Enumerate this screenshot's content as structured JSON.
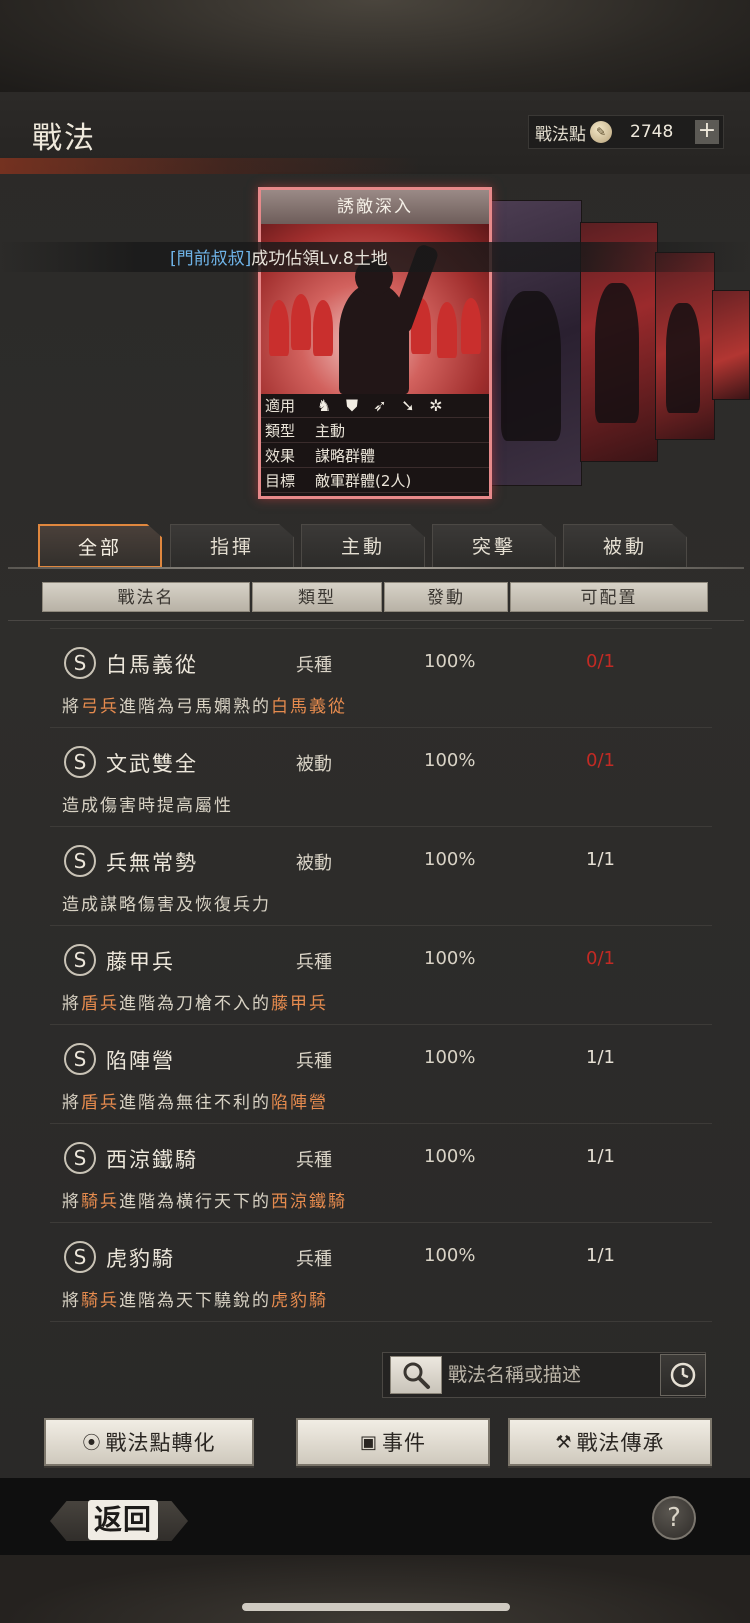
{
  "header": {
    "title": "戰法",
    "points_label": "戰法點",
    "points_value": "2748",
    "plus_label": "+"
  },
  "notice": {
    "user": "[門前叔叔]",
    "message": "成功佔領Lv.8土地"
  },
  "card": {
    "title": "誘敵深入",
    "rows": [
      {
        "key": "適用",
        "value": ""
      },
      {
        "key": "類型",
        "value": "主動"
      },
      {
        "key": "效果",
        "value": "謀略群體"
      },
      {
        "key": "目標",
        "value": "敵軍群體(2人)"
      }
    ],
    "unit_icons": [
      "cavalry-icon",
      "shield-icon",
      "bow-icon",
      "spear-icon",
      "wheel-icon"
    ]
  },
  "tabs": [
    "全部",
    "指揮",
    "主動",
    "突擊",
    "被動"
  ],
  "active_tab": 0,
  "columns": [
    "戰法名",
    "類型",
    "發動",
    "可配置"
  ],
  "tactics": [
    {
      "grade": "S",
      "name": "白馬義從",
      "type": "兵種",
      "rate": "100%",
      "slots": "0/1",
      "slot_red": true,
      "desc": [
        {
          "t": "將",
          "h": false
        },
        {
          "t": "弓兵",
          "h": true
        },
        {
          "t": "進階為弓馬嫻熟的",
          "h": false
        },
        {
          "t": "白馬義從",
          "h": true
        }
      ]
    },
    {
      "grade": "S",
      "name": "文武雙全",
      "type": "被動",
      "rate": "100%",
      "slots": "0/1",
      "slot_red": true,
      "desc": [
        {
          "t": "造成傷害時提高屬性",
          "h": false
        }
      ]
    },
    {
      "grade": "S",
      "name": "兵無常勢",
      "type": "被動",
      "rate": "100%",
      "slots": "1/1",
      "slot_red": false,
      "desc": [
        {
          "t": "造成謀略傷害及恢復兵力",
          "h": false
        }
      ]
    },
    {
      "grade": "S",
      "name": "藤甲兵",
      "type": "兵種",
      "rate": "100%",
      "slots": "0/1",
      "slot_red": true,
      "desc": [
        {
          "t": "將",
          "h": false
        },
        {
          "t": "盾兵",
          "h": true
        },
        {
          "t": "進階為刀槍不入的",
          "h": false
        },
        {
          "t": "藤甲兵",
          "h": true
        }
      ]
    },
    {
      "grade": "S",
      "name": "陷陣營",
      "type": "兵種",
      "rate": "100%",
      "slots": "1/1",
      "slot_red": false,
      "desc": [
        {
          "t": "將",
          "h": false
        },
        {
          "t": "盾兵",
          "h": true
        },
        {
          "t": "進階為無往不利的",
          "h": false
        },
        {
          "t": "陷陣營",
          "h": true
        }
      ]
    },
    {
      "grade": "S",
      "name": "西涼鐵騎",
      "type": "兵種",
      "rate": "100%",
      "slots": "1/1",
      "slot_red": false,
      "desc": [
        {
          "t": "將",
          "h": false
        },
        {
          "t": "騎兵",
          "h": true
        },
        {
          "t": "進階為橫行天下的",
          "h": false
        },
        {
          "t": "西涼鐵騎",
          "h": true
        }
      ]
    },
    {
      "grade": "S",
      "name": "虎豹騎",
      "type": "兵種",
      "rate": "100%",
      "slots": "1/1",
      "slot_red": false,
      "desc": [
        {
          "t": "將",
          "h": false
        },
        {
          "t": "騎兵",
          "h": true
        },
        {
          "t": "進階為天下驍銳的",
          "h": false
        },
        {
          "t": "虎豹騎",
          "h": true
        }
      ]
    }
  ],
  "search": {
    "placeholder": "戰法名稱或描述"
  },
  "buttons": {
    "convert": "戰法點轉化",
    "event": "事件",
    "inherit": "戰法傳承"
  },
  "footer": {
    "back": "返回",
    "help": "?"
  },
  "colors": {
    "highlight": "#e68b4e",
    "slot_full": "#c22a24",
    "active_tab_border": "#e0873e",
    "card_border": "#e7898a",
    "notice_user": "#6fb4e8"
  }
}
